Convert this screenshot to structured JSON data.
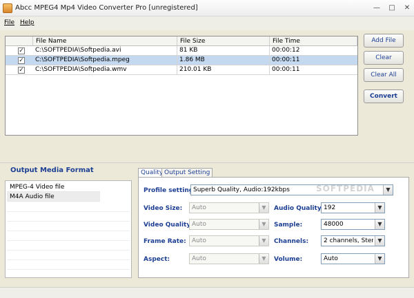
{
  "window": {
    "title": "Abcc MPEG4 Mp4 Video Converter Pro  [unregistered]"
  },
  "menu": {
    "file": "File",
    "help": "Help"
  },
  "filelist": {
    "columns": [
      "File Name",
      "File Size",
      "File Time"
    ],
    "rows": [
      {
        "checked": true,
        "name": "C:\\SOFTPEDIA\\Softpedia.avi",
        "size": "81 KB",
        "time": "00:00:12",
        "selected": false
      },
      {
        "checked": true,
        "name": "C:\\SOFTPEDIA\\Softpedia.mpeg",
        "size": "1.86 MB",
        "time": "00:00:11",
        "selected": true
      },
      {
        "checked": true,
        "name": "C:\\SOFTPEDIA\\Softpedia.wmv",
        "size": "210.01 KB",
        "time": "00:00:11",
        "selected": false
      }
    ]
  },
  "buttons": {
    "add_file": "Add File",
    "clear": "Clear",
    "clear_all": "Clear All",
    "convert": "Convert"
  },
  "output": {
    "title": "Output Media Format",
    "formats": [
      "MPEG-4 Video file",
      "M4A Audio file"
    ],
    "selected_index": 1
  },
  "tabs": {
    "quality": "Quality",
    "output_setting": "Output Setting"
  },
  "settings": {
    "profile_label": "Profile setting:",
    "profile_value": "Superb Quality, Audio:192kbps",
    "video_size_label": "Video Size:",
    "video_size": "Auto",
    "video_quality_label": "Video Quality:",
    "video_quality": "Auto",
    "frame_rate_label": "Frame Rate:",
    "frame_rate": "Auto",
    "aspect_label": "Aspect:",
    "aspect": "Auto",
    "audio_quality_label": "Audio Quality:",
    "audio_quality": "192",
    "sample_label": "Sample:",
    "sample": "48000",
    "channels_label": "Channels:",
    "channels": "2 channels, Ster",
    "volume_label": "Volume:",
    "volume": "Auto"
  },
  "watermark": "SOFTPEDIA"
}
